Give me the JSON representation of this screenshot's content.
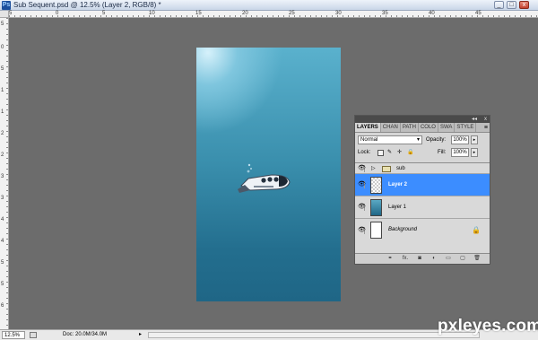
{
  "window": {
    "icon_text": "Ps",
    "title": "Sub Sequent.psd @ 12.5% (Layer 2, RGB/8) *",
    "minimize": "_",
    "maximize": "□",
    "close": "x"
  },
  "rulers": {
    "top_labels": [
      "5",
      "0",
      "5",
      "10",
      "15",
      "20",
      "25",
      "30",
      "35",
      "40",
      "45"
    ],
    "left_labels": [
      "5",
      "0",
      "5",
      "1",
      "1",
      "2",
      "2",
      "3",
      "3",
      "4",
      "4",
      "5",
      "5",
      "6"
    ]
  },
  "layers_panel": {
    "collapse": "◂◂",
    "close": "x",
    "menu": "≡",
    "tabs": [
      {
        "label": "LAYERS",
        "active": true
      },
      {
        "label": "CHAN",
        "active": false
      },
      {
        "label": "PATH",
        "active": false
      },
      {
        "label": "COLO",
        "active": false
      },
      {
        "label": "SWA",
        "active": false
      },
      {
        "label": "STYLE",
        "active": false
      }
    ],
    "blend_mode": "Normal",
    "opacity_label": "Opacity:",
    "opacity_value": "100%",
    "lock_label": "Lock:",
    "fill_label": "Fill:",
    "fill_value": "100%",
    "layers": [
      {
        "name": "sub",
        "type": "group",
        "visible": true,
        "selected": false
      },
      {
        "name": "Layer 2",
        "type": "layer",
        "visible": true,
        "selected": true
      },
      {
        "name": "Layer 1",
        "type": "layer",
        "visible": true,
        "selected": false
      },
      {
        "name": "Background",
        "type": "background",
        "visible": true,
        "selected": false,
        "locked": true
      }
    ],
    "footer_icons": [
      "link-icon",
      "fx-icon",
      "mask-icon",
      "adjustment-icon",
      "folder-icon",
      "new-layer-icon",
      "trash-icon"
    ],
    "footer_fx": "fx."
  },
  "statusbar": {
    "zoom": "12.5%",
    "doc_info": "Doc: 20.0M/34.0M",
    "arrow": "▸"
  },
  "watermark": "pxleyes.com",
  "colors": {
    "selection": "#3c8dff",
    "workspace": "#6c6c6c",
    "canvas_top": "#5ab1cd",
    "canvas_bottom": "#1f6686"
  }
}
